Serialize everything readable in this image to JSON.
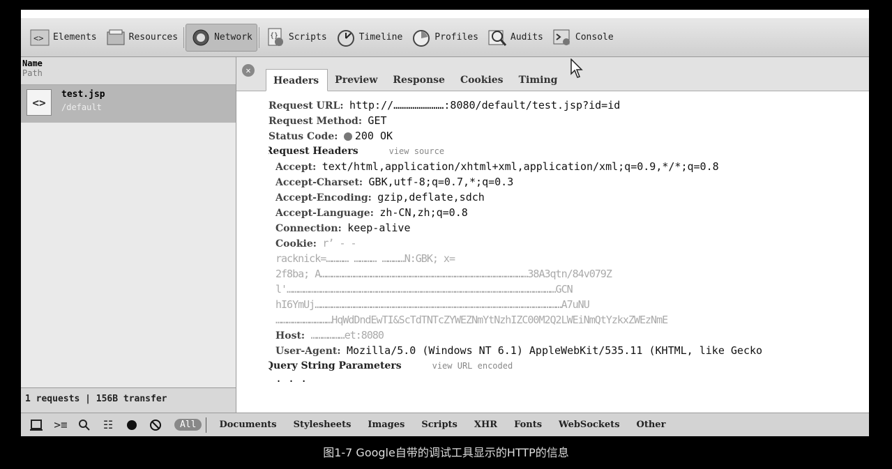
{
  "toolbar": {
    "tabs": [
      "Elements",
      "Resources",
      "Network",
      "Scripts",
      "Timeline",
      "Profiles",
      "Audits",
      "Console"
    ],
    "active": "Network"
  },
  "left": {
    "col_name": "Name",
    "col_path": "Path",
    "request": {
      "name": "test.jsp",
      "path": "/default"
    },
    "status": "1 requests  |  156B transfer"
  },
  "detail": {
    "tabs": [
      "Headers",
      "Preview",
      "Response",
      "Cookies",
      "Timing"
    ],
    "active_tab": "Headers",
    "general": [
      {
        "k": "Request URL:",
        "v": "http://……………………:8080/default/test.jsp?id=id"
      },
      {
        "k": "Request Method:",
        "v": "GET"
      },
      {
        "k": "Status Code:",
        "v": "200 OK"
      }
    ],
    "request_headers_title": "Request Headers",
    "view_source": "view source",
    "headers": [
      {
        "k": "Accept:",
        "v": "text/html,application/xhtml+xml,application/xml;q=0.9,*/*;q=0.8"
      },
      {
        "k": "Accept-Charset:",
        "v": "GBK,utf-8;q=0.7,*;q=0.3"
      },
      {
        "k": "Accept-Encoding:",
        "v": "gzip,deflate,sdch"
      },
      {
        "k": "Accept-Language:",
        "v": "zh-CN,zh;q=0.8"
      },
      {
        "k": "Connection:",
        "v": "keep-alive"
      },
      {
        "k": "Cookie:",
        "v": "rʼ ‐ ‐"
      }
    ],
    "cookie_lines": [
      "racknick=………… ………… …………N:GBK; x=",
      "2f8ba; A…………………………………………………………………………………………………38A3qtn/84v079Z",
      "l'………………………………………………………………………………………………………………………………GCN",
      "hI6YmUj……………………………………………………………………………………………………………………A7uNU",
      "…………………………HqWdDndEwTI&ScTdTNTcZYWEZNmYtNzhIZC00M2Q2LWEiNmQtYzkxZWEzNmE"
    ],
    "headers_tail": [
      {
        "k": "Host:",
        "v": "………………et:8080"
      },
      {
        "k": "User-Agent:",
        "v": "Mozilla/5.0 (Windows NT 6.1) AppleWebKit/535.11 (KHTML, like Gecko"
      }
    ],
    "query_title": "Query String Parameters",
    "view_url_encoded": "view URL encoded",
    "query_line": "· · ·"
  },
  "bottom": {
    "all": "All",
    "filters": [
      "Documents",
      "Stylesheets",
      "Images",
      "Scripts",
      "XHR",
      "Fonts",
      "WebSockets",
      "Other"
    ]
  },
  "caption": "图1-7 Google自带的调试工具显示的HTTP的信息"
}
